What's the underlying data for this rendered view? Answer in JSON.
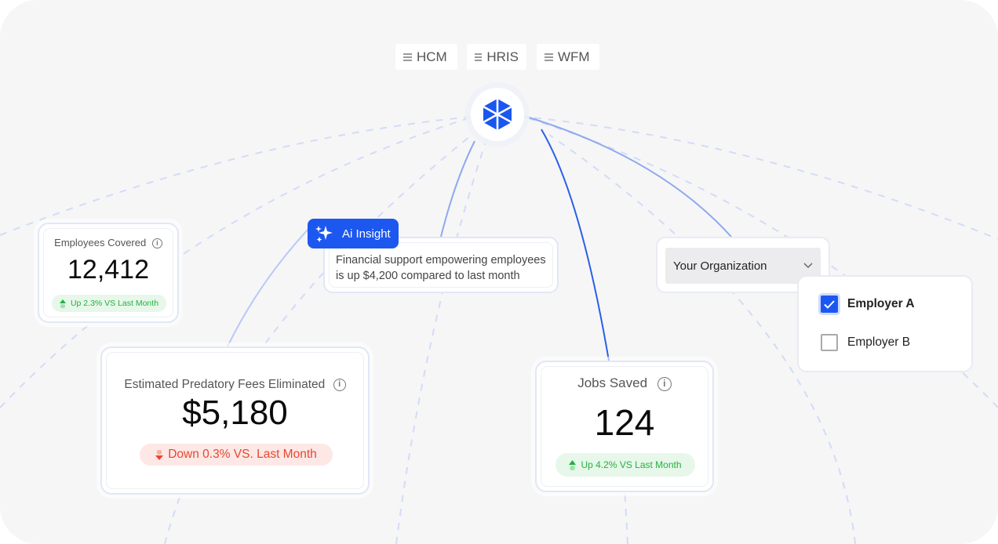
{
  "source_tabs": [
    {
      "label": "HCM"
    },
    {
      "label": "HRIS"
    },
    {
      "label": "WFM"
    }
  ],
  "employees_card": {
    "title": "Employees Covered",
    "value": "12,412",
    "trend": "Up 2.3% VS Last Month",
    "trend_direction": "up"
  },
  "fees_card": {
    "title": "Estimated Predatory Fees Eliminated",
    "value": "$5,180",
    "trend": "Down 0.3% VS. Last Month",
    "trend_direction": "down"
  },
  "jobs_card": {
    "title": "Jobs Saved",
    "value": "124",
    "trend": "Up 4.2% VS Last Month",
    "trend_direction": "up"
  },
  "ai_insight": {
    "tag": "Ai Insight",
    "text": "Financial support empowering employees is up $4,200 compared to last month"
  },
  "organization": {
    "select_label": "Your Organization",
    "employers": [
      {
        "label": "Employer A",
        "checked": true
      },
      {
        "label": "Employer B",
        "checked": false
      }
    ]
  },
  "colors": {
    "accent": "#1c57ef",
    "up": "#24b13d",
    "down": "#e8462e",
    "background": "#f6f6f7"
  },
  "icons": {
    "hub": "hexagon-logo-icon",
    "info": "info-icon",
    "sparkle": "sparkle-icon",
    "chevron": "chevron-down-icon"
  }
}
